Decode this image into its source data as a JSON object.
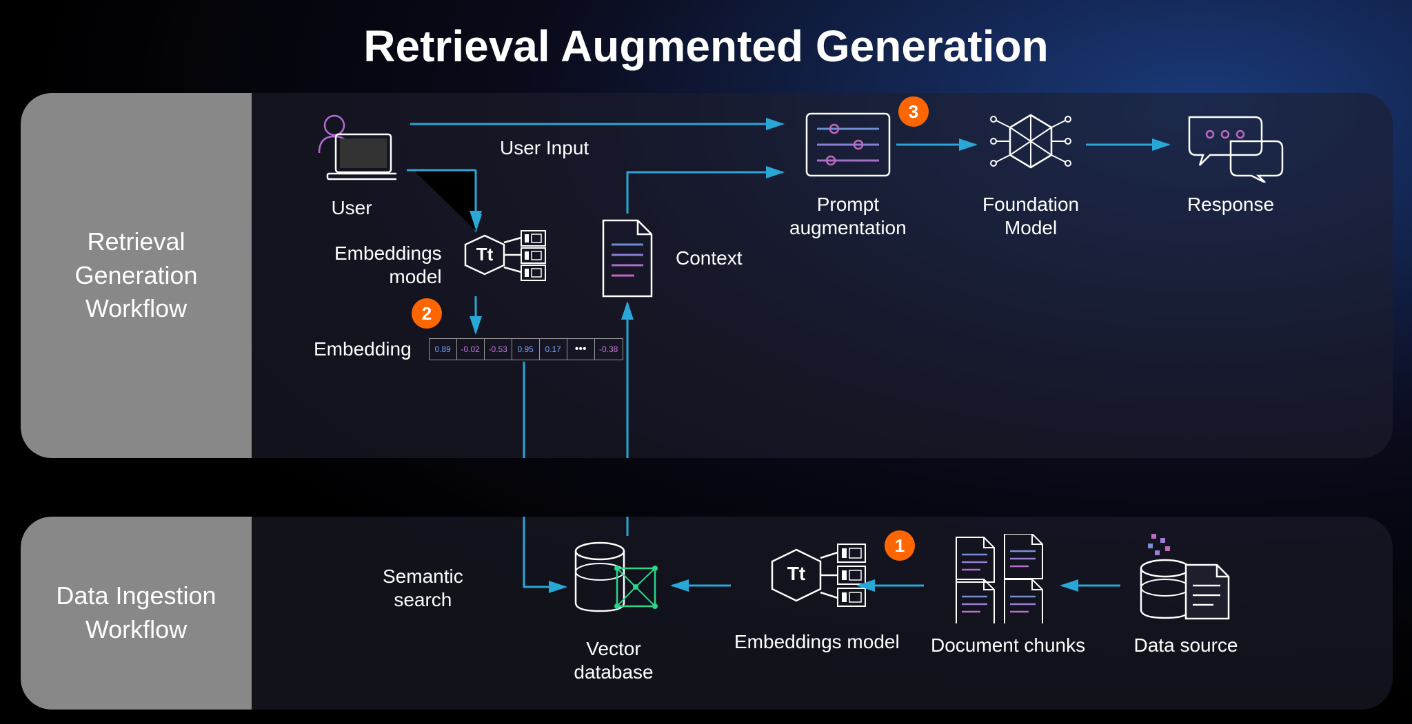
{
  "title": "Retrieval Augmented Generation",
  "panels": {
    "retrieval": {
      "label_l1": "Retrieval",
      "label_l2": "Generation",
      "label_l3": "Workflow"
    },
    "ingestion": {
      "label_l1": "Data Ingestion",
      "label_l2": "Workflow"
    }
  },
  "steps": {
    "s1": "1",
    "s2": "2",
    "s3": "3"
  },
  "nodes": {
    "user": "User",
    "user_input": "User Input",
    "embeddings_model": "Embeddings\nmodel",
    "embedding": "Embedding",
    "context": "Context",
    "prompt_aug_l1": "Prompt",
    "prompt_aug_l2": "augmentation",
    "foundation_l1": "Foundation",
    "foundation_l2": "Model",
    "response": "Response",
    "semantic_l1": "Semantic",
    "semantic_l2": "search",
    "vector_db_l1": "Vector",
    "vector_db_l2": "database",
    "embeddings_model2": "Embeddings model",
    "doc_chunks": "Document chunks",
    "data_source": "Data source"
  },
  "embedding_values": [
    "0.89",
    "-0.02",
    "-0.53",
    "0.95",
    "0.17",
    "•••",
    "-0.38"
  ]
}
